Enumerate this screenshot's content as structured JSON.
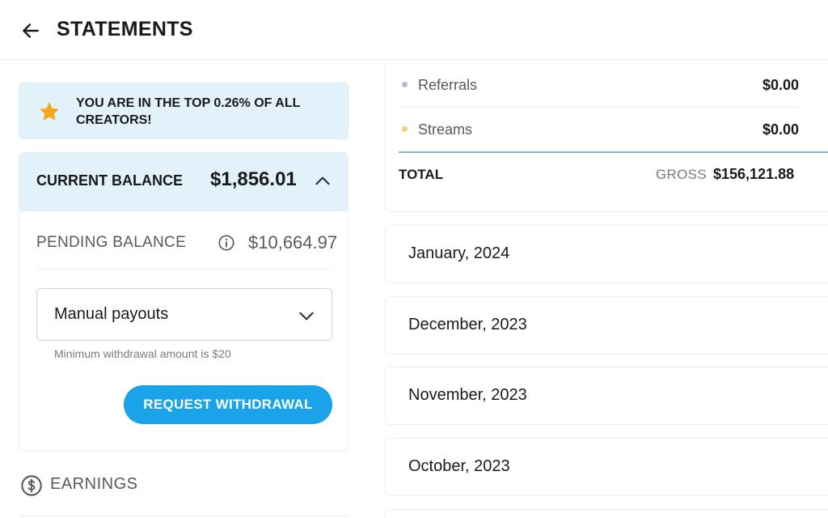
{
  "header": {
    "title": "STATEMENTS",
    "back_icon": "arrow-left-icon"
  },
  "banner": {
    "icon": "star-icon",
    "icon_color": "#f7a61b",
    "text": "YOU ARE IN THE TOP 0.26% OF ALL CREATORS!"
  },
  "balance": {
    "label": "CURRENT BALANCE",
    "value": "$1,856.01",
    "pending_label": "PENDING BALANCE",
    "pending_value": "$10,664.97",
    "payout_mode": "Manual payouts",
    "min_note": "Minimum withdrawal amount is $20",
    "withdraw_label": "REQUEST WITHDRAWAL",
    "accent": "#1aa3e8"
  },
  "earnings": {
    "label": "EARNINGS",
    "icon": "dollar-circle-icon"
  },
  "summary": {
    "rows": [
      {
        "label": "Referrals",
        "value": "$0.00",
        "dot_color": "#b9b7d8"
      },
      {
        "label": "Streams",
        "value": "$0.00",
        "dot_color": "#f0cc7c"
      }
    ],
    "total_label": "TOTAL",
    "gross_label": "GROSS",
    "gross_value": "$156,121.88"
  },
  "months": [
    {
      "label": "January, 2024"
    },
    {
      "label": "December, 2023"
    },
    {
      "label": "November, 2023"
    },
    {
      "label": "October, 2023"
    }
  ]
}
